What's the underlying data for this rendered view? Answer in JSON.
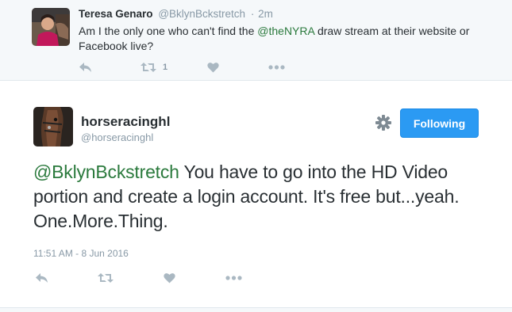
{
  "parent_tweet": {
    "display_name": "Teresa Genaro",
    "handle": "@BklynBckstretch",
    "separator": "·",
    "time": "2m",
    "text_before": "Am I the only one who can't find the ",
    "mention": "@theNYRA",
    "text_after": " draw stream at their website or Facebook live?",
    "retweet_count": "1",
    "actions": {
      "reply_icon": "reply-icon",
      "retweet_icon": "retweet-icon",
      "like_icon": "heart-icon",
      "more_icon": "more-dots-icon"
    }
  },
  "main_tweet": {
    "display_name": "horseracinghl",
    "handle": "@horseracinghl",
    "follow_button": "Following",
    "settings_icon": "gear-icon",
    "mention": "@BklynBckstretch",
    "text_after": " You have to go into the HD Video portion and create a login account. It's free but...yeah. One.More.Thing.",
    "timestamp": "11:51 AM - 8 Jun 2016",
    "actions": {
      "reply_icon": "reply-icon",
      "retweet_icon": "retweet-icon",
      "like_icon": "heart-icon",
      "more_icon": "more-dots-icon"
    }
  },
  "colors": {
    "mention_green": "#2b7a3d",
    "follow_blue": "#2b9af3",
    "muted_gray": "#8899a6",
    "icon_gray": "#aab8c2",
    "context_bg": "#f5f8fa"
  }
}
